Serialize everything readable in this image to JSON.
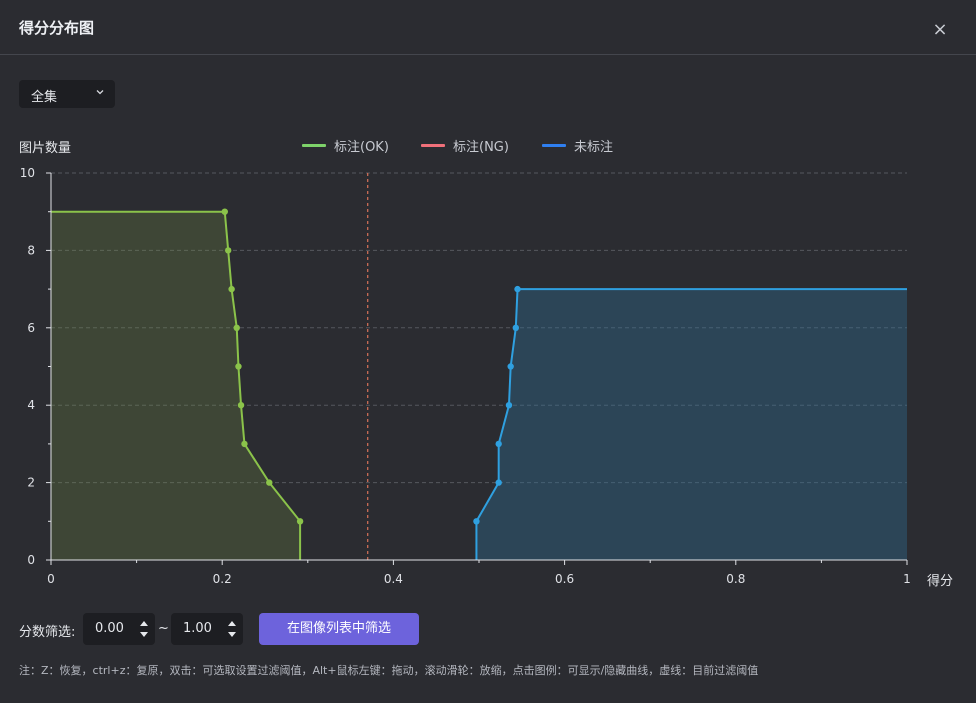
{
  "dialog": {
    "title": "得分分布图",
    "close_glyph": "×"
  },
  "dataset_select": {
    "value": "全集",
    "icon": "chevron-down-icon"
  },
  "chart_data": {
    "type": "area",
    "ylabel": "图片数量",
    "xlabel": "得分",
    "xlim": [
      0,
      1
    ],
    "ylim": [
      0,
      10
    ],
    "x_ticks": [
      "0",
      "0.2",
      "0.4",
      "0.6",
      "0.8",
      "1"
    ],
    "y_ticks": [
      "0",
      "2",
      "4",
      "6",
      "8",
      "10"
    ],
    "grid": "horizontal-dashed",
    "legend_position": "top-center",
    "threshold": 0.37,
    "series": [
      {
        "name": "标注(OK)",
        "color": "#8bc34a",
        "legend_color": "#7ed36a",
        "points": [
          [
            0,
            9
          ],
          [
            0.203,
            9
          ],
          [
            0.207,
            8
          ],
          [
            0.211,
            7
          ],
          [
            0.217,
            6
          ],
          [
            0.219,
            5
          ],
          [
            0.222,
            4
          ],
          [
            0.226,
            3
          ],
          [
            0.255,
            2
          ],
          [
            0.291,
            1
          ],
          [
            0.291,
            0
          ]
        ]
      },
      {
        "name": "标注(NG)",
        "color": "#f0707a",
        "legend_color": "#f0707a",
        "points": []
      },
      {
        "name": "未标注",
        "color": "#2fa0e0",
        "legend_color": "#2f7ff0",
        "points": [
          [
            0.497,
            0
          ],
          [
            0.497,
            1
          ],
          [
            0.523,
            2
          ],
          [
            0.523,
            3
          ],
          [
            0.535,
            4
          ],
          [
            0.537,
            5
          ],
          [
            0.543,
            6
          ],
          [
            0.545,
            7
          ],
          [
            1,
            7
          ]
        ]
      }
    ]
  },
  "filter": {
    "label": "分数筛选:",
    "min_value": "0.00",
    "max_value": "1.00",
    "separator": "~",
    "button_label": "在图像列表中筛选"
  },
  "note": "注：Z：恢复，ctrl+z：复原，双击：可选取设置过滤阈值，Alt+鼠标左键：拖动，滚动滑轮：放缩，点击图例：可显示/隐藏曲线，虚线：目前过滤阈值"
}
